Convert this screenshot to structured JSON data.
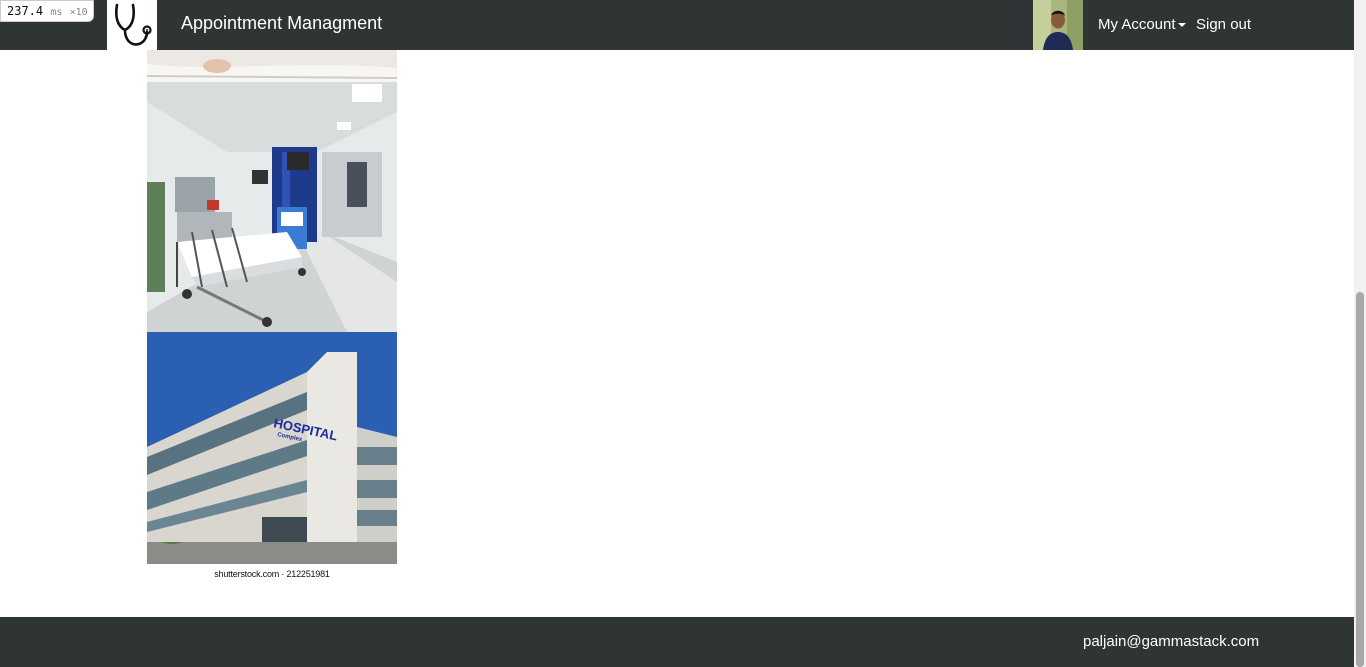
{
  "perf": {
    "value": "237.4",
    "unit": "ms",
    "multiplier": "×10"
  },
  "navbar": {
    "title": "Appointment Managment",
    "logo_icon": "stethoscope-icon",
    "my_account": "My Account",
    "sign_out": "Sign out"
  },
  "images": {
    "caption": "shutterstock.com · 212251981",
    "sign_text": "HOSPITAL",
    "sign_subtext": "Complex"
  },
  "footer": {
    "email": "paljain@gammastack.com"
  },
  "colors": {
    "navbar_bg": "#2f3435",
    "accent_text": "#ffffff"
  }
}
